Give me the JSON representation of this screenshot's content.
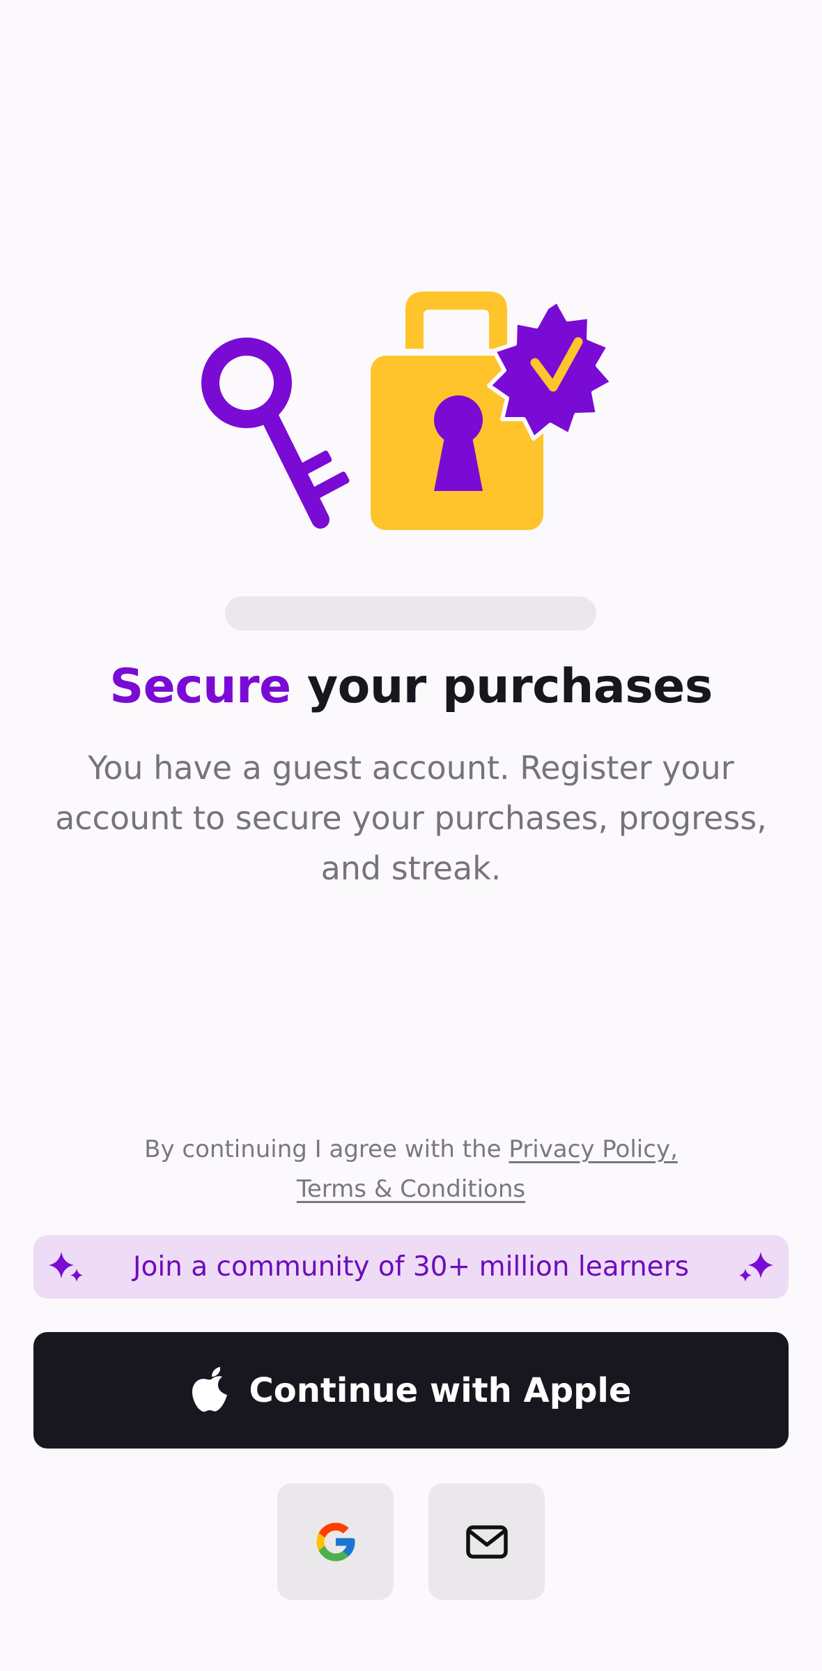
{
  "colors": {
    "accent": "#7a0bd4",
    "lock_yellow": "#ffc42b",
    "dark": "#18161f",
    "background": "#fcf9fc",
    "community_bg": "#eedcf6"
  },
  "hero": {
    "icons": [
      "key-icon",
      "padlock-icon",
      "verified-badge-icon"
    ]
  },
  "onboarding": {
    "progress": 0
  },
  "heading": {
    "accent_word": "Secure",
    "rest": " your purchases"
  },
  "body_text": "You have a guest account. Register your account to secure your purchases, progress, and streak.",
  "legal": {
    "prefix": "By continuing I agree with the ",
    "privacy_link": "Privacy Policy,",
    "terms_link": "Terms & Conditions"
  },
  "community_banner": {
    "label": "Join a community of 30+ million learners",
    "icon": "sparkle-icon"
  },
  "apple_button": {
    "label": "Continue with Apple",
    "icon": "apple-icon"
  },
  "alt_sign_in": [
    {
      "icon": "google-icon"
    },
    {
      "icon": "mail-icon"
    }
  ]
}
